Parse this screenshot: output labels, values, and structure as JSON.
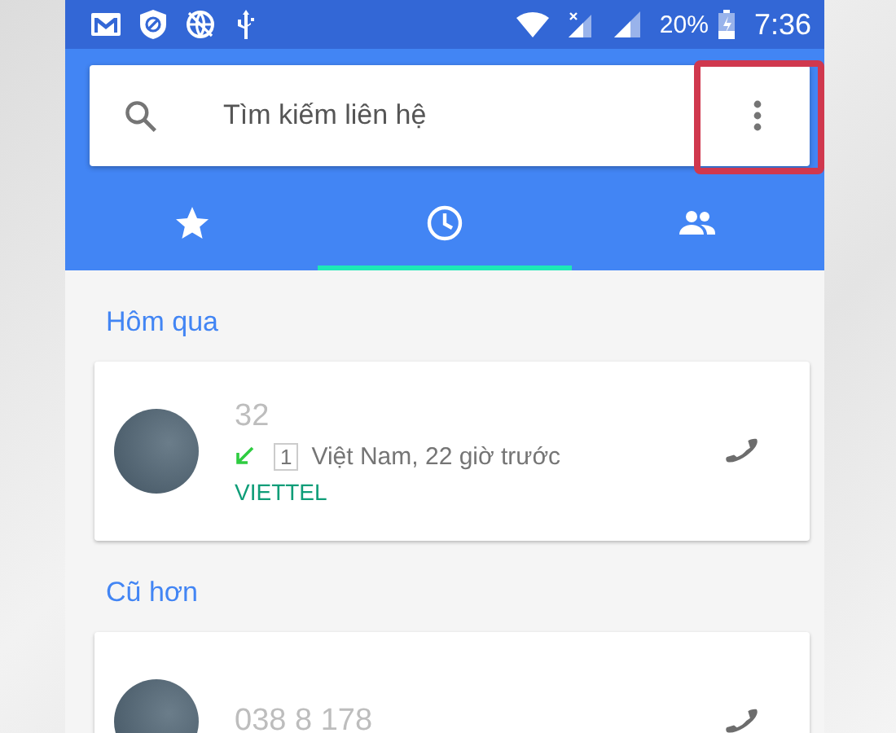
{
  "status_bar": {
    "battery": "20%",
    "time": "7:36"
  },
  "search": {
    "placeholder": "Tìm kiếm liên hệ",
    "menu_highlighted": true
  },
  "tabs": [
    {
      "kind": "favorites",
      "selected": false
    },
    {
      "kind": "recents",
      "selected": true
    },
    {
      "kind": "contacts",
      "selected": false
    }
  ],
  "sections": [
    {
      "title": "Hôm qua",
      "calls": [
        {
          "number": "32",
          "kind": "incoming",
          "count": "1",
          "detail": "Việt Nam, 22 giờ trước",
          "carrier": "VIETTEL"
        }
      ]
    },
    {
      "title": "Cũ hơn",
      "calls": [
        {
          "number": "038 8 178"
        }
      ]
    }
  ]
}
